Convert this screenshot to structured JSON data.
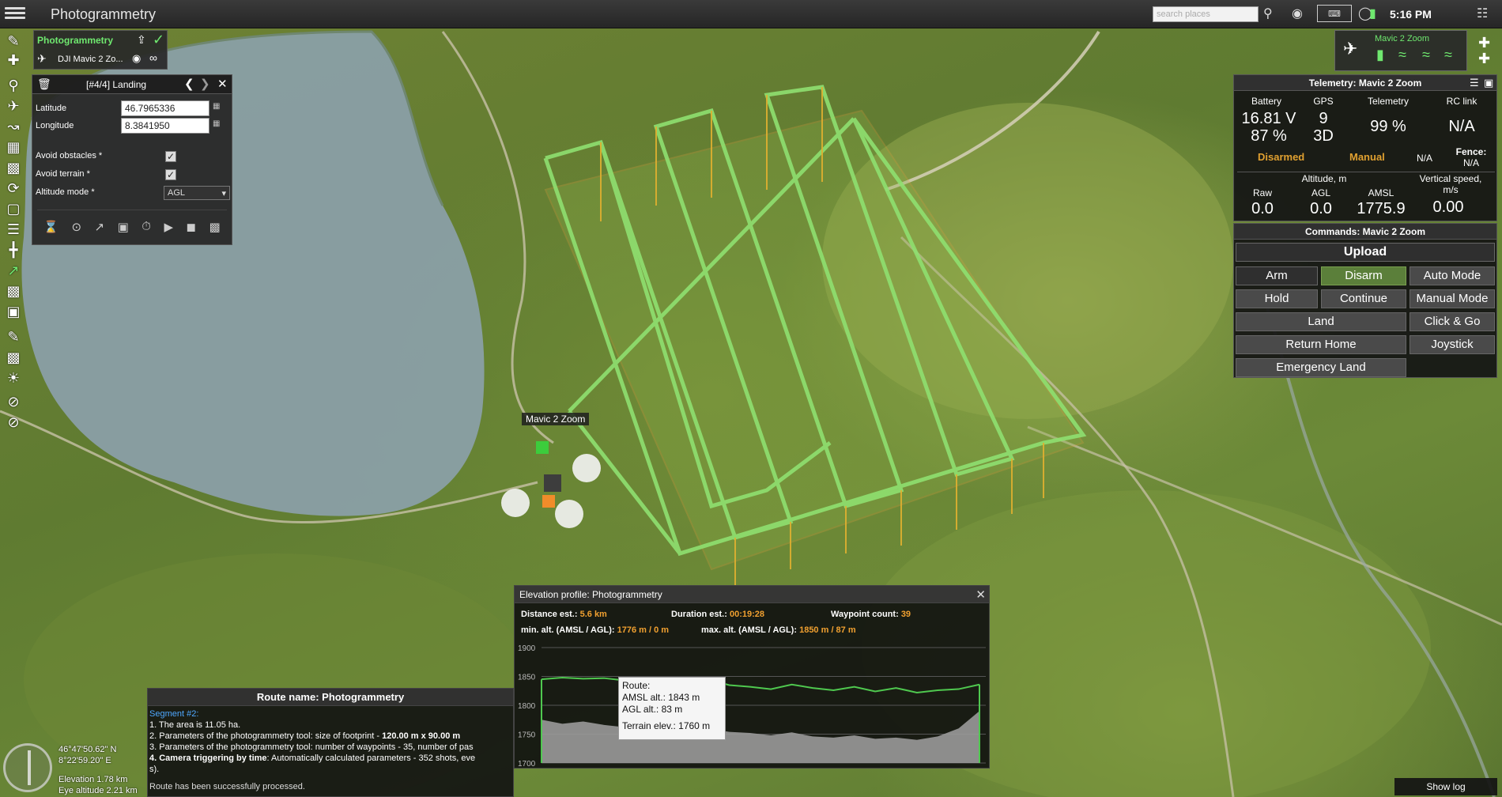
{
  "app": {
    "title": "Photogrammetry",
    "time": "5:16 PM"
  },
  "search": {
    "placeholder": "search places"
  },
  "mission": {
    "name": "Photogrammetry",
    "vehicle": "DJI Mavic 2 Zo..."
  },
  "waypoint": {
    "title": "[#4/4] Landing",
    "latitude_label": "Latitude",
    "latitude": "46.7965336",
    "longitude_label": "Longitude",
    "longitude": "8.3841950",
    "avoid_obstacles_label": "Avoid obstacles *",
    "avoid_obstacles": true,
    "avoid_terrain_label": "Avoid terrain *",
    "avoid_terrain": true,
    "altitude_mode_label": "Altitude mode *",
    "altitude_mode": "AGL"
  },
  "vehicle_widget": {
    "name": "Mavic 2 Zoom"
  },
  "map": {
    "vehicle_label": "Mavic 2 Zoom"
  },
  "telemetry": {
    "title": "Telemetry: Mavic 2 Zoom",
    "battery_label": "Battery",
    "battery_voltage": "16.81 V",
    "battery_percent": "87 %",
    "gps_label": "GPS",
    "gps_sats": "9",
    "gps_fix": "3D",
    "telemetry_label": "Telemetry",
    "telemetry_value": "99 %",
    "rc_label": "RC link",
    "rc_value": "N/A",
    "armed_state": "Disarmed",
    "mode": "Manual",
    "na": "N/A",
    "fence_label": "Fence:",
    "fence_value": "N/A",
    "altitude_label": "Altitude, m",
    "raw_label": "Raw",
    "raw_value": "0.0",
    "agl_label": "AGL",
    "agl_value": "0.0",
    "amsl_label": "AMSL",
    "amsl_value": "1775.9",
    "vspeed_label": "Vertical speed, m/s",
    "vspeed_value": "0.00"
  },
  "commands": {
    "title": "Commands: Mavic 2 Zoom",
    "upload": "Upload",
    "arm": "Arm",
    "disarm": "Disarm",
    "auto_mode": "Auto Mode",
    "hold": "Hold",
    "continue": "Continue",
    "manual_mode": "Manual Mode",
    "land": "Land",
    "click_go": "Click & Go",
    "return_home": "Return Home",
    "joystick": "Joystick",
    "emergency_land": "Emergency Land"
  },
  "elevation": {
    "title": "Elevation profile: Photogrammetry",
    "distance_label": "Distance est.:",
    "distance": "5.6 km",
    "duration_label": "Duration est.:",
    "duration": "00:19:28",
    "waypoints_label": "Waypoint count:",
    "waypoints": "39",
    "min_label": "min. alt. (AMSL / AGL):",
    "min_value": "1776 m / 0 m",
    "max_label": "max. alt. (AMSL / AGL):",
    "max_value": "1850 m / 87 m",
    "tooltip_route": "Route:",
    "tooltip_amsl": "AMSL alt.: 1843 m",
    "tooltip_agl": "AGL alt.: 83 m",
    "tooltip_terrain": "Terrain elev.: 1760 m"
  },
  "chart_data": {
    "type": "line",
    "yticks": [
      1900,
      1850,
      1800,
      1750,
      1700
    ],
    "ylim": [
      1700,
      1900
    ],
    "series": [
      {
        "name": "Route",
        "values": [
          1845,
          1848,
          1846,
          1847,
          1843,
          1838,
          1834,
          1840,
          1845,
          1835,
          1832,
          1828,
          1836,
          1830,
          1826,
          1832,
          1824,
          1830,
          1822,
          1826,
          1828,
          1836
        ]
      },
      {
        "name": "Terrain",
        "values": [
          1775,
          1768,
          1772,
          1766,
          1762,
          1760,
          1764,
          1758,
          1760,
          1754,
          1752,
          1748,
          1753,
          1746,
          1744,
          1748,
          1742,
          1744,
          1740,
          1746,
          1760,
          1790
        ]
      }
    ]
  },
  "route": {
    "title": "Route name: Photogrammetry",
    "segment": "Segment #2:",
    "line1": "1. The area is 11.05 ha.",
    "line2_a": "2. Parameters of the photogrammetry tool: size of footprint - ",
    "line2_b": "120.00 m x 90.00 m",
    "line3": "3. Parameters of the photogrammetry tool: number of waypoints - 35, number of pas",
    "line4_a": "4. Camera triggering by time",
    "line4_b": ": Automatically calculated parameters - 352 shots, eve",
    "line5": "s).",
    "status": "Route has been successfully processed."
  },
  "coords": {
    "lat": "46°47'50.62\" N",
    "lon": "8°22'59.20\" E",
    "elevation": "Elevation 1.78 km",
    "eye": "Eye altitude 2.21 km"
  },
  "log": {
    "show_log": "Show log"
  }
}
